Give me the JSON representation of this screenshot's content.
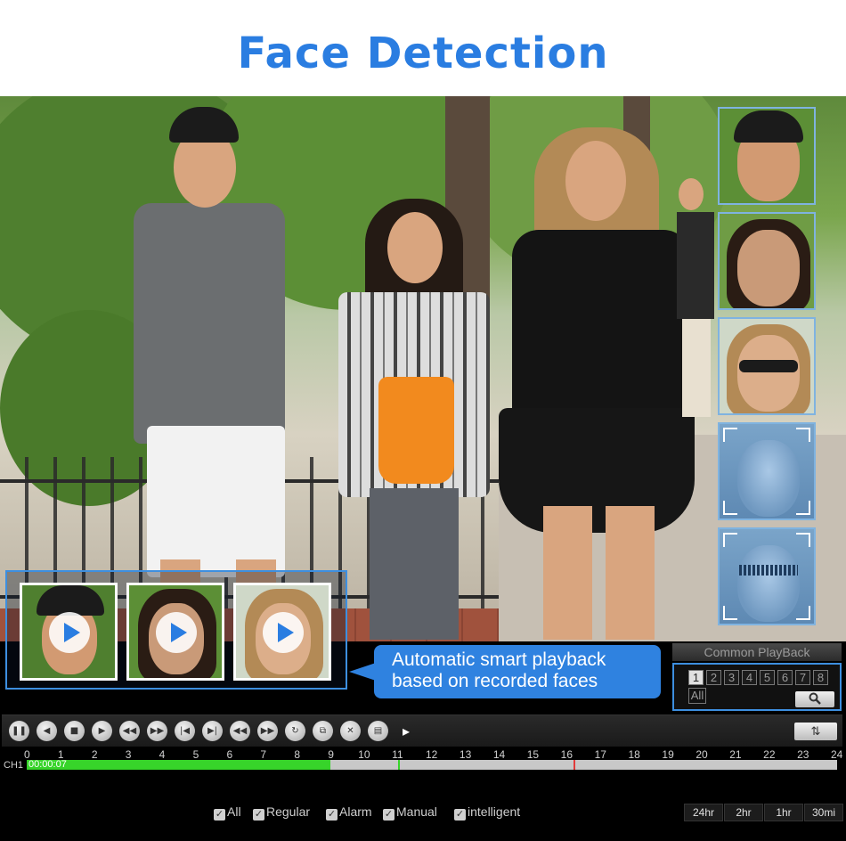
{
  "page": {
    "title": "Face Detection",
    "title_color": "#2a7de1"
  },
  "callout": {
    "line1": "Automatic smart playback",
    "line2": "based on recorded faces",
    "bg_color": "#2f82e0"
  },
  "common_playback": {
    "title": "Common PlayBack",
    "channels": [
      "1",
      "2",
      "3",
      "4",
      "5",
      "6",
      "7",
      "8"
    ],
    "active_channel": "1",
    "all_label": "All",
    "search_icon": "search-icon"
  },
  "controls": [
    {
      "name": "pause-icon",
      "glyph": "❚❚"
    },
    {
      "name": "rewind-play-icon",
      "glyph": "◀"
    },
    {
      "name": "stop-icon",
      "glyph": "■"
    },
    {
      "name": "play-icon",
      "glyph": "▶"
    },
    {
      "name": "fast-rewind-icon",
      "glyph": "◀◀"
    },
    {
      "name": "fast-forward-icon",
      "glyph": "▶▶"
    },
    {
      "name": "previous-frame-icon",
      "glyph": "|◀"
    },
    {
      "name": "next-frame-icon",
      "glyph": "▶|"
    },
    {
      "name": "skip-back-icon",
      "glyph": "◀◀"
    },
    {
      "name": "skip-forward-icon",
      "glyph": "▶▶"
    },
    {
      "name": "loop-icon",
      "glyph": "↻"
    },
    {
      "name": "clip-icon",
      "glyph": "⧉"
    },
    {
      "name": "close-icon",
      "glyph": "✕"
    },
    {
      "name": "save-icon",
      "glyph": "▤"
    }
  ],
  "sync_icon": "sync-arrows-icon",
  "timeline": {
    "channel": "CH1",
    "time": "00:00:07",
    "hours": [
      "0",
      "1",
      "2",
      "3",
      "4",
      "5",
      "6",
      "7",
      "8",
      "9",
      "10",
      "11",
      "12",
      "13",
      "14",
      "15",
      "16",
      "17",
      "18",
      "19",
      "20",
      "21",
      "22",
      "23",
      "24"
    ],
    "recorded_until_hour": 9.0,
    "marks": [
      {
        "hour": 11.0,
        "color": "#37d42a"
      },
      {
        "hour": 16.2,
        "color": "#e23b3b"
      }
    ],
    "record_color": "#37d42a"
  },
  "filters": [
    {
      "label": "All",
      "checked": true
    },
    {
      "label": "Regular",
      "checked": true
    },
    {
      "label": "Alarm",
      "checked": true
    },
    {
      "label": "Manual",
      "checked": true
    },
    {
      "label": "intelligent",
      "checked": true
    }
  ],
  "ranges": [
    "24hr",
    "2hr",
    "1hr",
    "30mi"
  ]
}
